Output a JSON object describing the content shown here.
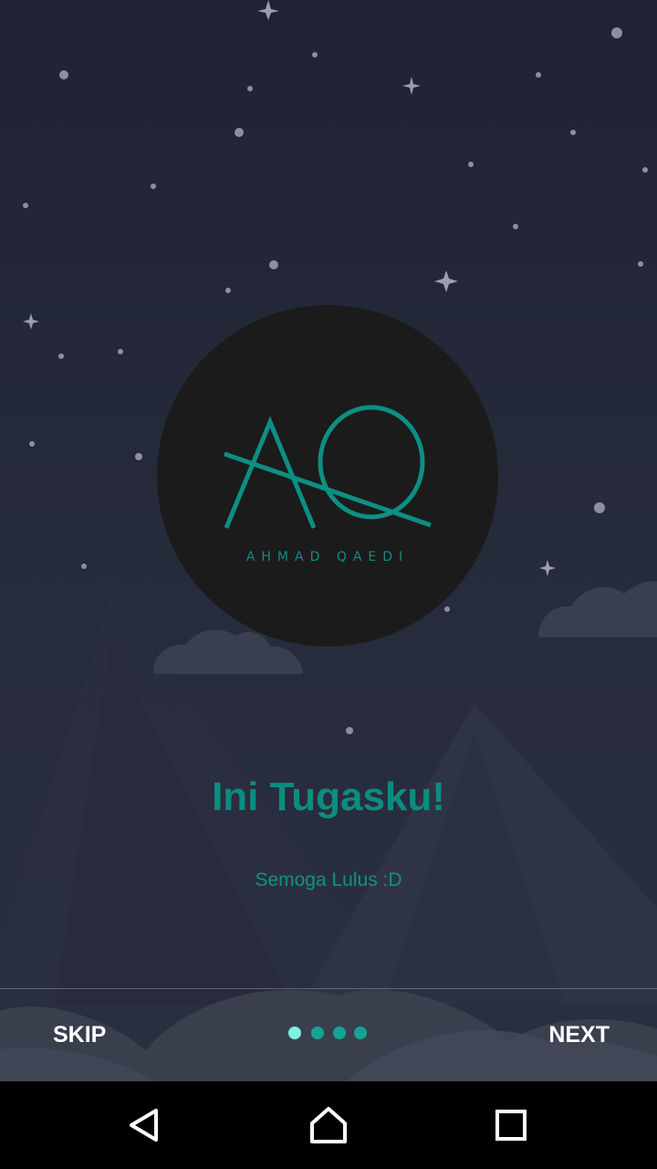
{
  "onboarding": {
    "logo": {
      "monogram": "AQ",
      "caption": "AHMAD QAEDI",
      "color": "#0d8f84"
    },
    "headline": "Ini Tugasku!",
    "subtitle": "Semoga Lulus :D",
    "skip_label": "SKIP",
    "next_label": "NEXT",
    "page_indicator": {
      "total": 4,
      "current": 1
    },
    "colors": {
      "accent": "#0c8c80",
      "dot_active": "#7cf2e2",
      "dot_inactive": "#17a393",
      "background": "#23283a"
    }
  },
  "system_nav": {
    "back_icon": "back-triangle-icon",
    "home_icon": "home-icon",
    "recents_icon": "recents-square-icon"
  }
}
